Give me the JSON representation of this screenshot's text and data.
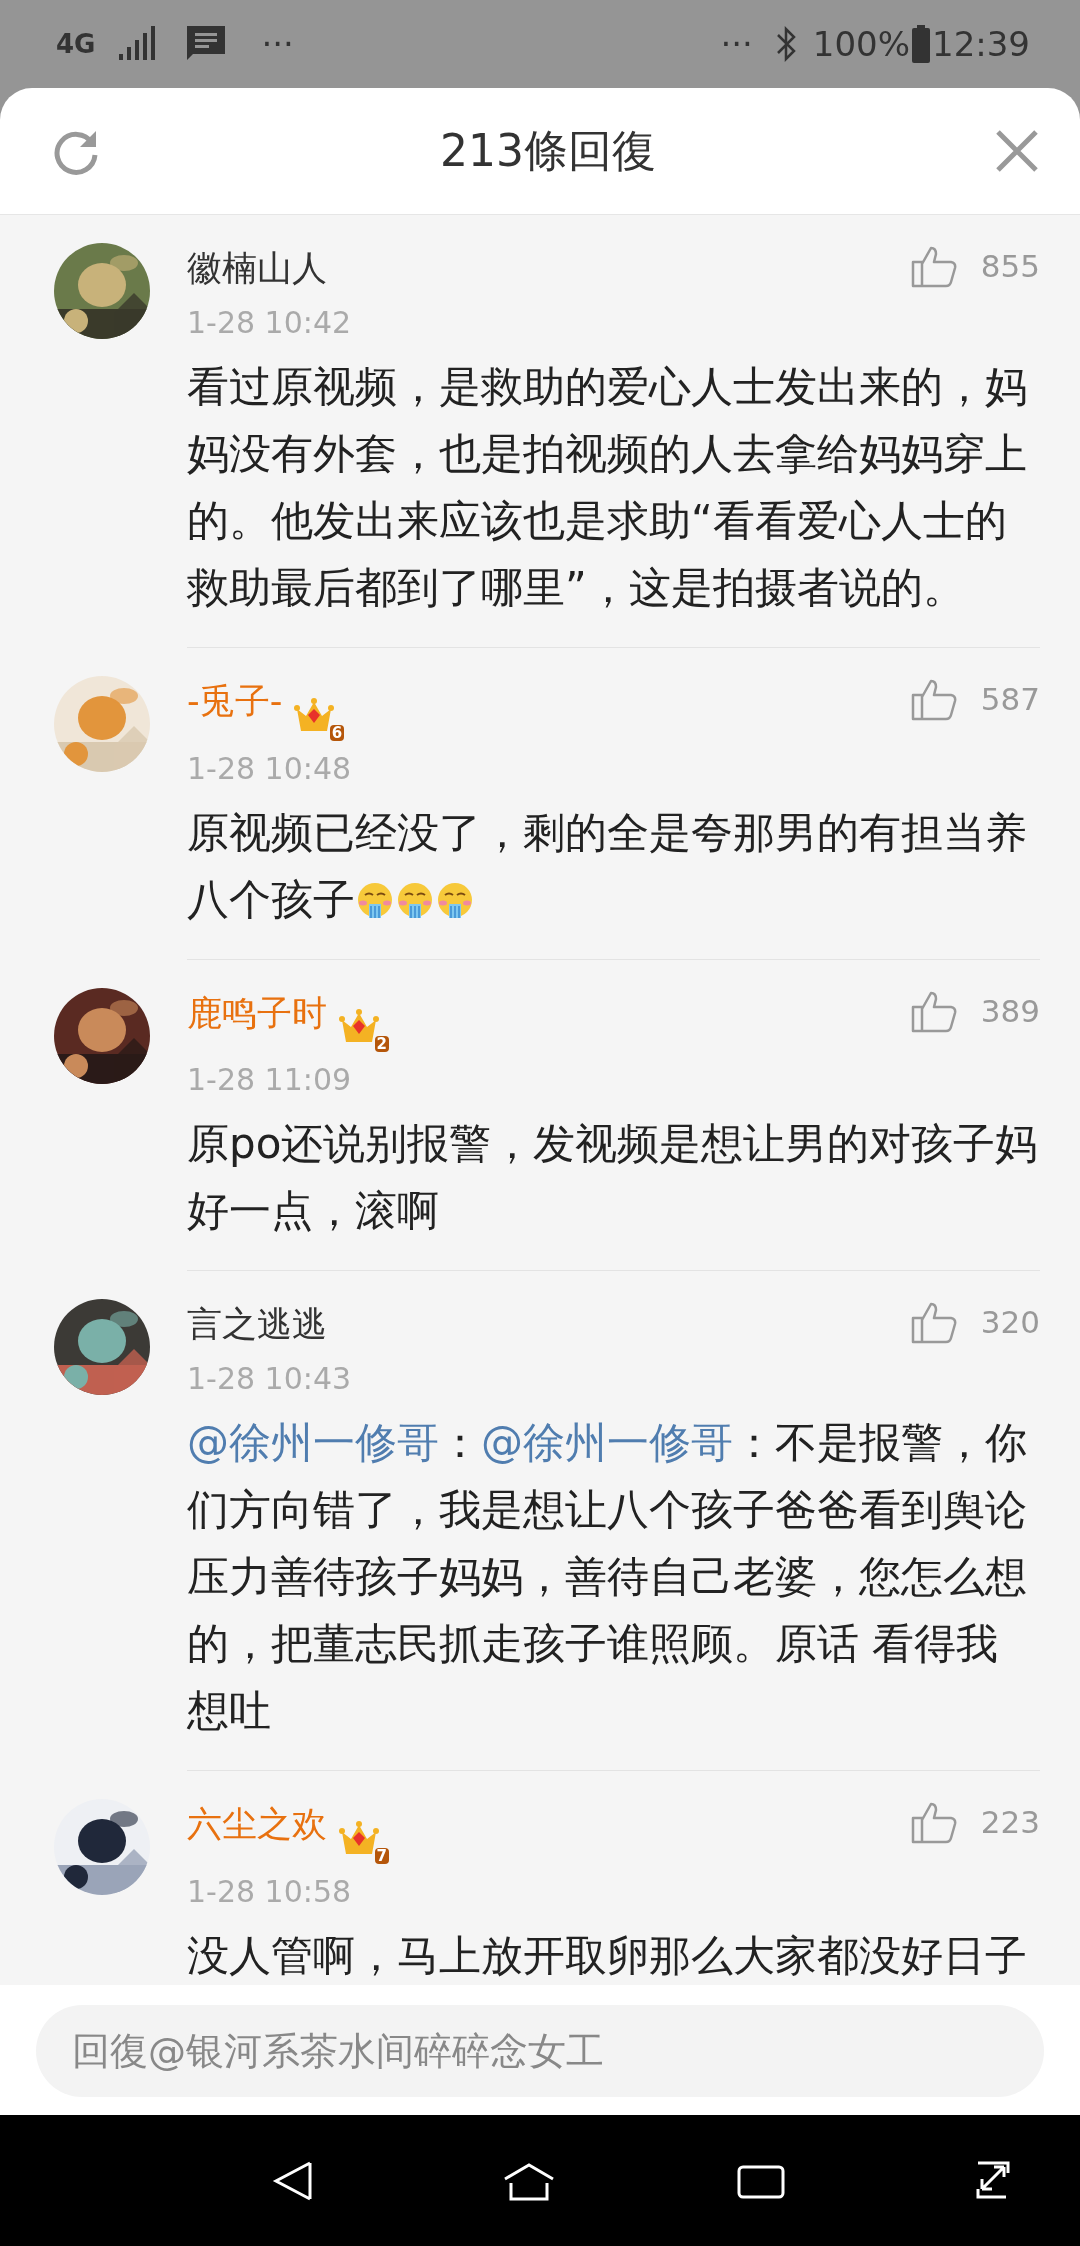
{
  "status_bar": {
    "network": "4G",
    "left_more": "···",
    "right_more": "···",
    "battery": "100%",
    "time": "12:39"
  },
  "header": {
    "title": "213條回復"
  },
  "comments": [
    {
      "author": "徽楠山人",
      "vip": false,
      "date": "1-28 10:42",
      "likes": "855",
      "content": [
        {
          "kind": "text",
          "text": "看过原视频，是救助的爱心人士发出来的，妈妈没有外套，也是拍视频的人去拿给妈妈穿上的。他发出来应该也是求助“看看爱心人士的救助最后都到了哪里”，这是拍摄者说的。"
        }
      ]
    },
    {
      "author": "-兎子-",
      "vip": true,
      "vip_level": "6",
      "date": "1-28 10:48",
      "likes": "587",
      "content": [
        {
          "kind": "text",
          "text": "原视频已经没了，剩的全是夸那男的有担当养八个孩子"
        },
        {
          "kind": "emoji"
        },
        {
          "kind": "emoji"
        },
        {
          "kind": "emoji"
        }
      ]
    },
    {
      "author": "鹿鸣子时",
      "vip": true,
      "vip_level": "2",
      "date": "1-28 11:09",
      "likes": "389",
      "content": [
        {
          "kind": "text",
          "text": "原po还说别报警，发视频是想让男的对孩子妈好一点，滚啊"
        }
      ]
    },
    {
      "author": "言之逃逃",
      "vip": false,
      "date": "1-28 10:43",
      "likes": "320",
      "content": [
        {
          "kind": "mention",
          "text": "@徐州一修哥"
        },
        {
          "kind": "text",
          "text": "："
        },
        {
          "kind": "mention",
          "text": "@徐州一修哥"
        },
        {
          "kind": "text",
          "text": "：不是报警，你们方向错了，我是想让八个孩子爸爸看到舆论压力善待孩子妈妈，善待自己老婆，您怎么想的，把董志民抓走孩子谁照顾。原话 看得我想吐"
        }
      ]
    },
    {
      "author": "六尘之欢",
      "vip": true,
      "vip_level": "7",
      "date": "1-28 10:58",
      "likes": "223",
      "content": [
        {
          "kind": "text",
          "text": "没人管啊，马上放开取卵那么大家都没好日子"
        }
      ]
    }
  ],
  "reply_box": {
    "placeholder": "回復@银河系茶水间碎碎念女工"
  }
}
